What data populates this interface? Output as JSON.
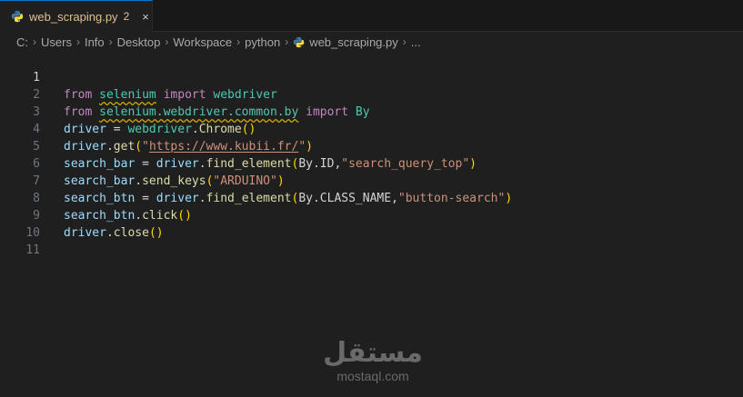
{
  "tab": {
    "label": "web_scraping.py",
    "badge": "2",
    "close": "×",
    "icon": "python-icon"
  },
  "breadcrumb": {
    "items": [
      "C:",
      "Users",
      "Info",
      "Desktop",
      "Workspace",
      "python"
    ],
    "file": "web_scraping.py",
    "ellipsis": "...",
    "separator": "›"
  },
  "editor": {
    "active_line": 1,
    "line_numbers": [
      "1",
      "2",
      "3",
      "4",
      "5",
      "6",
      "7",
      "8",
      "9",
      "10",
      "11"
    ],
    "lines": [
      "from selenium import webdriver",
      "from selenium.webdriver.common.by import By",
      "driver = webdriver.Chrome()",
      "driver.get(\"https://www.kubii.fr/\")",
      "search_bar = driver.find_element(By.ID,\"search_query_top\")",
      "search_bar.send_keys(\"ARDUINO\")",
      "search_btn = driver.find_element(By.CLASS_NAME,\"button-search\")",
      "search_btn.click()",
      "driver.close()",
      "",
      ""
    ],
    "tokens": {
      "l1": [
        "from",
        "selenium",
        "import",
        "webdriver"
      ],
      "l2": [
        "from",
        "selenium.webdriver.common.by",
        "import",
        "By"
      ],
      "l3": [
        "driver",
        "=",
        "webdriver",
        ".",
        "Chrome",
        "(",
        ")"
      ],
      "l4": [
        "driver",
        ".",
        "get",
        "(",
        "\"",
        "https://www.kubii.fr/",
        "\"",
        ")"
      ],
      "l5": [
        "search_bar",
        "=",
        "driver",
        ".",
        "find_element",
        "(",
        "By",
        ".",
        "ID",
        ",",
        "\"search_query_top\"",
        ")"
      ],
      "l6": [
        "search_bar",
        ".",
        "send_keys",
        "(",
        "\"ARDUINO\"",
        ")"
      ],
      "l7": [
        "search_btn",
        "=",
        "driver",
        ".",
        "find_element",
        "(",
        "By",
        ".",
        "CLASS_NAME",
        ",",
        "\"button-search\"",
        ")"
      ],
      "l8": [
        "search_btn",
        ".",
        "click",
        "(",
        ")"
      ],
      "l9": [
        "driver",
        ".",
        "close",
        "(",
        ")"
      ]
    }
  },
  "watermark": {
    "arabic": "مستقل",
    "latin": "mostaql.com"
  },
  "colors": {
    "keyword": "#c586c0",
    "variable": "#9cdcfe",
    "function": "#dcdcaa",
    "string": "#ce9178",
    "class": "#4ec9b0",
    "warning": "#cca700",
    "accent": "#0078d4",
    "background": "#1f1f1f"
  }
}
